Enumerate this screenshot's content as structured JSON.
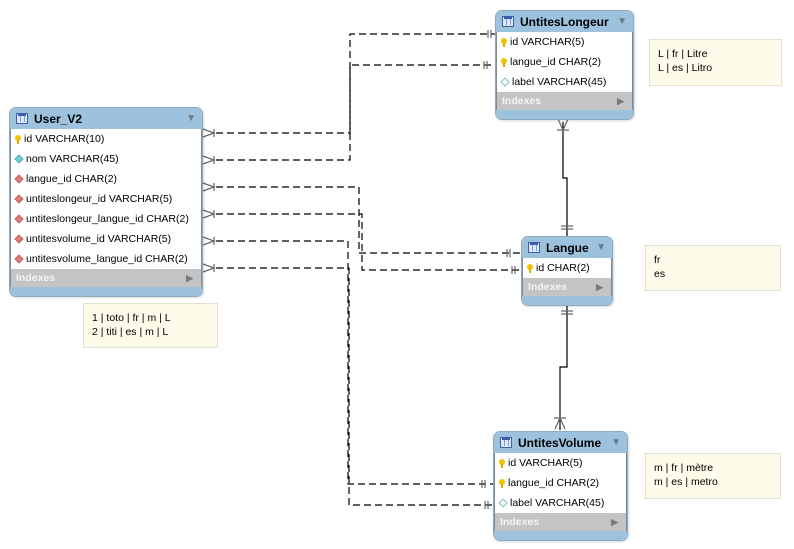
{
  "tables": {
    "user_v2": {
      "title": "User_V2",
      "columns": [
        {
          "icon": "primary-key-icon",
          "label": "id VARCHAR(10)"
        },
        {
          "icon": "nonnull-column-icon",
          "label": "nom VARCHAR(45)"
        },
        {
          "icon": "foreign-key-icon",
          "label": "langue_id CHAR(2)"
        },
        {
          "icon": "foreign-key-icon",
          "label": "untiteslongeur_id VARCHAR(5)"
        },
        {
          "icon": "foreign-key-icon",
          "label": "untiteslongeur_langue_id CHAR(2)"
        },
        {
          "icon": "foreign-key-icon",
          "label": "untitesvolume_id VARCHAR(5)"
        },
        {
          "icon": "foreign-key-icon",
          "label": "untitesvolume_langue_id CHAR(2)"
        }
      ],
      "indexes_label": "Indexes"
    },
    "untites_longeur": {
      "title": "UntitesLongeur",
      "columns": [
        {
          "icon": "primary-key-icon",
          "label": "id VARCHAR(5)"
        },
        {
          "icon": "primary-key-icon",
          "label": "langue_id CHAR(2)"
        },
        {
          "icon": "nullable-column-icon",
          "label": "label VARCHAR(45)"
        }
      ],
      "indexes_label": "Indexes"
    },
    "langue": {
      "title": "Langue",
      "columns": [
        {
          "icon": "primary-key-icon",
          "label": "id CHAR(2)"
        }
      ],
      "indexes_label": "Indexes"
    },
    "untites_volume": {
      "title": "UntitesVolume",
      "columns": [
        {
          "icon": "primary-key-icon",
          "label": "id VARCHAR(5)"
        },
        {
          "icon": "primary-key-icon",
          "label": "langue_id CHAR(2)"
        },
        {
          "icon": "nullable-column-icon",
          "label": "label VARCHAR(45)"
        }
      ],
      "indexes_label": "Indexes"
    }
  },
  "notes": {
    "user_v2": [
      "1 | toto | fr | m | L",
      "2 | titi | es | m | L"
    ],
    "untites_longeur": [
      "L | fr | Litre",
      "L | es | Litro"
    ],
    "langue": [
      "fr",
      "es"
    ],
    "untites_volume": [
      "m | fr | mètre",
      "m | es | metro"
    ]
  },
  "relationships": [
    {
      "from": "User_V2.untiteslongeur_id",
      "to": "UntitesLongeur.id",
      "style": "non-identifying",
      "cardinality": "many-to-one"
    },
    {
      "from": "User_V2.untiteslongeur_langue_id",
      "to": "UntitesLongeur.langue_id",
      "style": "non-identifying",
      "cardinality": "many-to-one"
    },
    {
      "from": "User_V2.langue_id",
      "to": "Langue.id",
      "style": "non-identifying",
      "cardinality": "many-to-one"
    },
    {
      "from": "User_V2.nom",
      "to": "Langue.id",
      "style": "non-identifying",
      "cardinality": "many-to-one"
    },
    {
      "from": "User_V2.untitesvolume_id",
      "to": "UntitesVolume.id",
      "style": "non-identifying",
      "cardinality": "many-to-one"
    },
    {
      "from": "User_V2.untitesvolume_langue_id",
      "to": "UntitesVolume.langue_id",
      "style": "non-identifying",
      "cardinality": "many-to-one"
    },
    {
      "from": "UntitesLongeur.langue_id",
      "to": "Langue.id",
      "style": "identifying",
      "cardinality": "many-to-one"
    },
    {
      "from": "UntitesVolume.langue_id",
      "to": "Langue.id",
      "style": "identifying",
      "cardinality": "many-to-one"
    }
  ]
}
